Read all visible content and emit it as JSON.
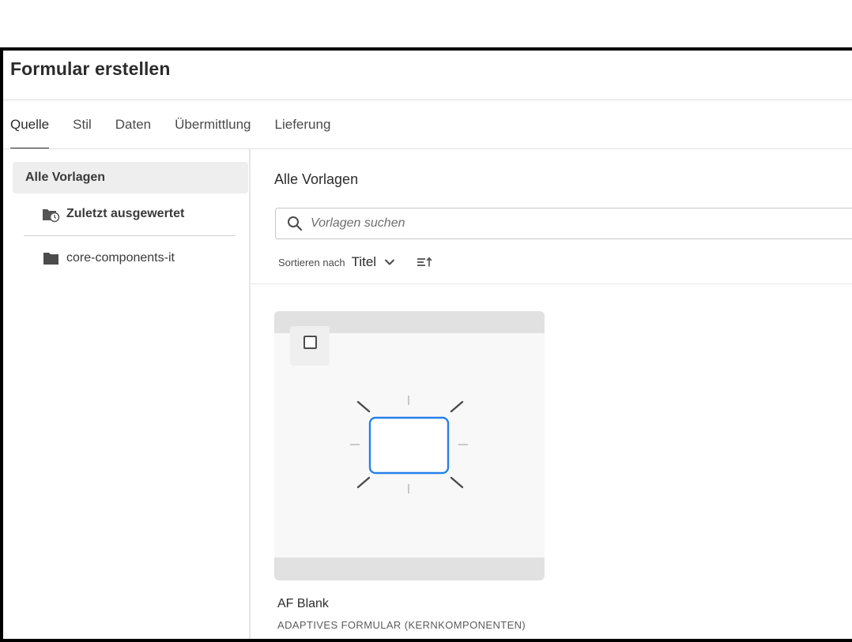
{
  "dialog": {
    "title": "Formular erstellen"
  },
  "tabs": [
    {
      "label": "Quelle",
      "active": true
    },
    {
      "label": "Stil",
      "active": false
    },
    {
      "label": "Daten",
      "active": false
    },
    {
      "label": "Übermittlung",
      "active": false
    },
    {
      "label": "Lieferung",
      "active": false
    }
  ],
  "sidebar": {
    "header": "Alle Vorlagen",
    "items": [
      {
        "label": "Zuletzt ausgewertet",
        "icon": "folder-recent-icon"
      },
      {
        "label": "core-components-it",
        "icon": "folder-icon"
      }
    ]
  },
  "main": {
    "title": "Alle Vorlagen",
    "search": {
      "placeholder": "Vorlagen suchen",
      "value": ""
    },
    "sort": {
      "label": "Sortieren nach",
      "value": "Titel"
    }
  },
  "cards": [
    {
      "title": "AF Blank",
      "subtitle": "ADAPTIVES FORMULAR (KERNKOMPONENTEN)",
      "selected": false
    }
  ],
  "colors": {
    "accent": "#2680eb",
    "text": "#2c2c2c",
    "card_bg": "#e1e1e1",
    "preview_bg": "#f8f8f8"
  }
}
